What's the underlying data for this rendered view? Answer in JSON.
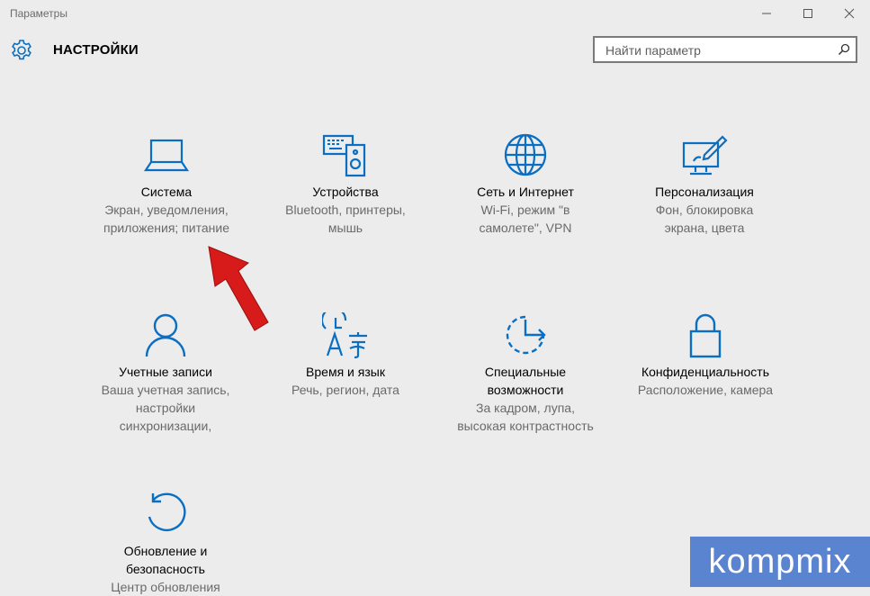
{
  "window": {
    "title": "Параметры",
    "controls": [
      "minimize",
      "maximize",
      "close"
    ]
  },
  "header": {
    "title": "НАСТРОЙКИ",
    "icon": "gear-icon"
  },
  "search": {
    "placeholder": "Найти параметр",
    "icon": "search-icon"
  },
  "accent_color": "#0a6fc2",
  "tiles": [
    {
      "name": "Система",
      "desc": [
        "Экран, уведомления,",
        "приложения; питание"
      ],
      "icon": "laptop-icon"
    },
    {
      "name": "Устройства",
      "desc": [
        "Bluetooth, принтеры,",
        "мышь"
      ],
      "icon": "devices-icon"
    },
    {
      "name": "Сеть и Интернет",
      "desc": [
        "Wi-Fi, режим \"в",
        "самолете\", VPN"
      ],
      "icon": "globe-icon"
    },
    {
      "name": "Персонализация",
      "desc": [
        "Фон, блокировка",
        "экрана, цвета"
      ],
      "icon": "personalization-icon"
    },
    {
      "name": "Учетные записи",
      "desc": [
        "Ваша учетная запись,",
        "настройки",
        "синхронизации,"
      ],
      "icon": "person-icon"
    },
    {
      "name": "Время и язык",
      "desc": [
        "Речь, регион, дата"
      ],
      "icon": "time-language-icon"
    },
    {
      "name": [
        "Специальные",
        "возможности"
      ],
      "desc": [
        "За кадром, лупа,",
        "высокая контрастность"
      ],
      "icon": "accessibility-icon"
    },
    {
      "name": "Конфиденциальность",
      "desc": [
        "Расположение, камера"
      ],
      "icon": "lock-icon"
    },
    {
      "name": [
        "Обновление и",
        "безопасность"
      ],
      "desc": [
        "Центр обновления"
      ],
      "icon": "update-icon"
    }
  ],
  "annotation": {
    "icon": "red-arrow-icon"
  },
  "watermark": {
    "text": "kompmix",
    "color": "#5a84cf"
  }
}
